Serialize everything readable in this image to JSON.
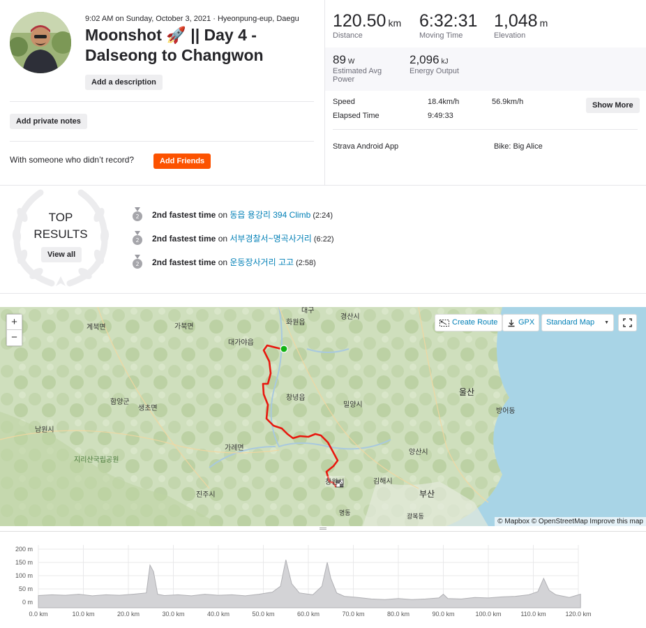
{
  "activity": {
    "meta": "9:02 AM on Sunday, October 3, 2021 · Hyeonpung-eup, Daegu",
    "title": "Moonshot 🚀 || Day 4 - Dalseong to Changwon",
    "add_description": "Add a description",
    "add_private_notes": "Add private notes",
    "someone_text": "With someone who didn’t record?",
    "add_friends": "Add Friends"
  },
  "stats": {
    "distance": {
      "value": "120.50",
      "unit": "km",
      "label": "Distance"
    },
    "moving_time": {
      "value": "6:32:31",
      "label": "Moving Time"
    },
    "elevation": {
      "value": "1,048",
      "unit": "m",
      "label": "Elevation"
    },
    "power": {
      "value": "89",
      "unit": "W",
      "label_line1": "Estimated Avg",
      "label_line2": "Power"
    },
    "energy": {
      "value": "2,096",
      "unit": "kJ",
      "label": "Energy Output"
    },
    "speed_label": "Speed",
    "speed_avg": "18.4km/h",
    "speed_max": "56.9km/h",
    "elapsed_label": "Elapsed Time",
    "elapsed_value": "9:49:33",
    "show_more": "Show More",
    "device": "Strava Android App",
    "bike": "Bike: Big Alice"
  },
  "top_results": {
    "title_line1": "TOP",
    "title_line2": "RESULTS",
    "view_all": "View all",
    "items": [
      {
        "rank": "2",
        "bold": "2nd fastest time",
        "on": " on ",
        "segment": "동읍 용강리 394 Climb",
        "time": " (2:24)"
      },
      {
        "rank": "2",
        "bold": "2nd fastest time",
        "on": " on ",
        "segment": "서부경찰서~명곡사거리",
        "time": " (6:22)"
      },
      {
        "rank": "2",
        "bold": "2nd fastest time",
        "on": " on ",
        "segment": "운동장사거리 고고",
        "time": " (2:58)"
      }
    ]
  },
  "map": {
    "create_route": "Create Route",
    "gpx": "GPX",
    "style": "Standard Map",
    "zoom_in": "+",
    "zoom_out": "−",
    "attribution": "© Mapbox © OpenStreetMap Improve this map",
    "places": [
      {
        "name": "대구"
      },
      {
        "name": "계북면"
      },
      {
        "name": "가북면"
      },
      {
        "name": "화원읍"
      },
      {
        "name": "경산시"
      },
      {
        "name": "대가야읍"
      },
      {
        "name": "함양군"
      },
      {
        "name": "생초면"
      },
      {
        "name": "창녕읍"
      },
      {
        "name": "밀양시"
      },
      {
        "name": "울산"
      },
      {
        "name": "방어동"
      },
      {
        "name": "남원시"
      },
      {
        "name": "가례면"
      },
      {
        "name": "지리산국립공원"
      },
      {
        "name": "양산시"
      },
      {
        "name": "김해시"
      },
      {
        "name": "창원시"
      },
      {
        "name": "부산"
      },
      {
        "name": "진주시"
      },
      {
        "name": "명동"
      },
      {
        "name": "광복동"
      }
    ]
  },
  "elevation_chart": {
    "y_ticks": [
      "200 m",
      "150 m",
      "100 m",
      "50 m",
      "0 m"
    ],
    "x_ticks": [
      "0.0 km",
      "10.0 km",
      "20.0 km",
      "30.0 km",
      "40.0 km",
      "50.0 km",
      "60.0 km",
      "70.0 km",
      "80.0 km",
      "90.0 km",
      "100.0 km",
      "110.0 km",
      "120.0 km"
    ],
    "ylim": [
      0,
      200
    ],
    "xlim": [
      0,
      120
    ],
    "profile_km": [
      0,
      3,
      6,
      9,
      12,
      15,
      18,
      21,
      24,
      24.8,
      25.6,
      26.5,
      28,
      31,
      34,
      37,
      40,
      43,
      46,
      49,
      52,
      53.8,
      55,
      56.3,
      58,
      61,
      63,
      64.2,
      65,
      66.3,
      68,
      71,
      74,
      77,
      80,
      83,
      86,
      89,
      90,
      91,
      94,
      97,
      100,
      103,
      106,
      109,
      111,
      112.3,
      113.5,
      115,
      118,
      120.5
    ],
    "profile_m": [
      25,
      28,
      26,
      30,
      24,
      28,
      26,
      30,
      35,
      140,
      115,
      30,
      25,
      28,
      24,
      30,
      26,
      28,
      24,
      30,
      38,
      60,
      160,
      70,
      35,
      28,
      60,
      150,
      90,
      35,
      22,
      18,
      12,
      10,
      14,
      10,
      12,
      16,
      30,
      14,
      12,
      18,
      16,
      20,
      22,
      28,
      40,
      90,
      45,
      28,
      18,
      30
    ]
  }
}
